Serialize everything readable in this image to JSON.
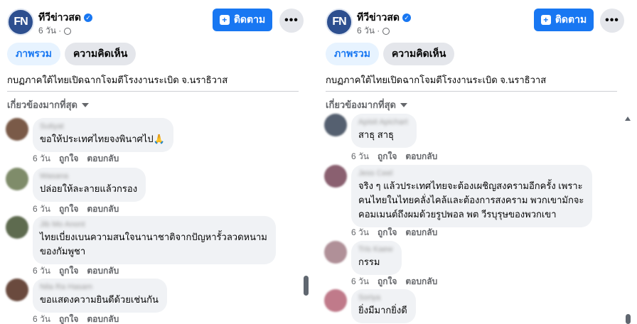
{
  "left": {
    "page_name": "ทีวีข่าวสด",
    "logo_text": "FN",
    "time_meta": "6 วัน ·",
    "follow_label": "ติดตาม",
    "more_label": "•••",
    "tabs": [
      {
        "label": "ภาพรวม"
      },
      {
        "label": "ความคิดเห็น"
      }
    ],
    "caption": "กบฏภาคใต้ไทยเปิดฉากโจมตีโรงงานระเบิด จ.นราธิวาส",
    "sort_label": "เกี่ยวข้องมากที่สุด",
    "comments": [
      {
        "author": "Sutiyat",
        "lines": [
          "ขอให้ประเทศไทยจงพินาศไป🙏"
        ],
        "time": "6 วัน",
        "like": "ถูกใจ",
        "reply": "ตอบกลับ",
        "avatar_color": "#7a5a48"
      },
      {
        "author": "Wasana",
        "lines": [
          "ปล่อยให้ละลายแล้วกรอง"
        ],
        "time": "6 วัน",
        "like": "ถูกใจ",
        "reply": "ตอบกลับ",
        "avatar_color": "#7f8c6a"
      },
      {
        "author": "Jib Mo Anont",
        "lines": [
          "ไทยเบี่ยงเบนความสนใจนานาชาติจากปัญหารั้วลวดหนาม",
          "ของกัมพูชา"
        ],
        "time": "6 วัน",
        "like": "ถูกใจ",
        "reply": "ตอบกลับ",
        "avatar_color": "#5e6b4f"
      },
      {
        "author": "Nila Ra Hasam",
        "lines": [
          "ขอแสดงความยินดีด้วยเช่นกัน"
        ],
        "time": "6 วัน",
        "like": "ถูกใจ",
        "reply": "ตอบกลับ",
        "avatar_color": "#6a4a3e"
      }
    ]
  },
  "right": {
    "page_name": "ทีวีข่าวสด",
    "logo_text": "FN",
    "time_meta": "6 วัน ·",
    "follow_label": "ติดตาม",
    "more_label": "•••",
    "tabs": [
      {
        "label": "ภาพรวม"
      },
      {
        "label": "ความคิดเห็น"
      }
    ],
    "caption": "กบฏภาคใต้ไทยเปิดฉากโจมตีโรงงานระเบิด จ.นราธิวาส",
    "sort_label": "เกี่ยวข้องมากที่สุด",
    "comments": [
      {
        "author": "Apisit Apichart",
        "lines": [
          "สาธุ สาธุ"
        ],
        "time": "6 วัน",
        "like": "ถูกใจ",
        "reply": "ตอบกลับ",
        "avatar_color": "#556070"
      },
      {
        "author": "Jess Ceel",
        "lines": [
          "จริง ๆ แล้วประเทศไทยจะต้องเผชิญสงครามอีกครั้ง เพราะ",
          "คนไทยในไทยคลั่งไคล้และต้องการสงคราม พวกเขามักจะ",
          "คอมเมนต์ถึงผมด้วยรูปพอล พต วีรบุรุษของพวกเขา"
        ],
        "time": "6 วัน",
        "like": "ถูกใจ",
        "reply": "ตอบกลับ",
        "avatar_color": "#8a6070"
      },
      {
        "author": "Tris Kaew",
        "lines": [
          "กรรม"
        ],
        "time": "6 วัน",
        "like": "ถูกใจ",
        "reply": "ตอบกลับ",
        "avatar_color": "#b09098"
      },
      {
        "author": "Soriya",
        "lines": [
          "ยิ่งมีมากยิ่งดี"
        ],
        "time": "",
        "like": "",
        "reply": "",
        "avatar_color": "#c07a8a"
      }
    ]
  }
}
